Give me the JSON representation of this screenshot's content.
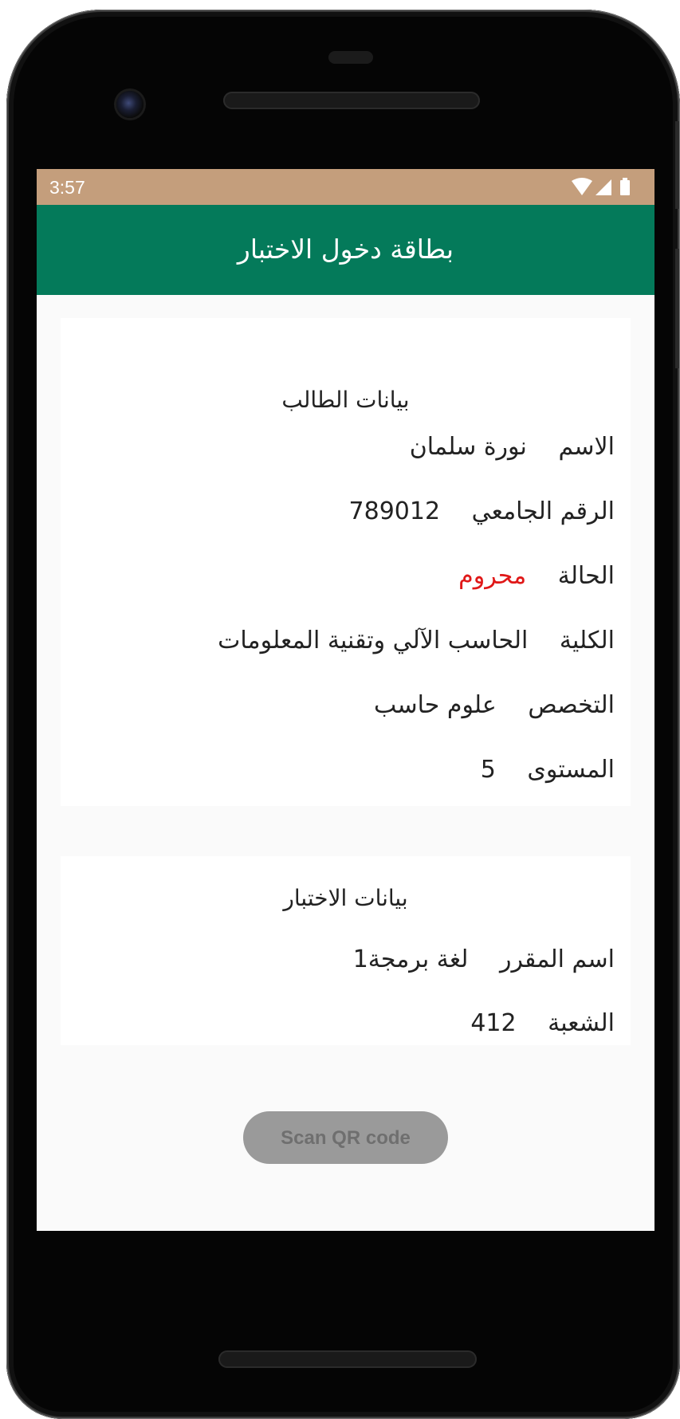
{
  "status_bar": {
    "time": "3:57",
    "icons": [
      "wifi-icon",
      "cellular-signal-icon",
      "battery-icon"
    ]
  },
  "app_bar": {
    "title": "بطاقة دخول الاختبار"
  },
  "student_card": {
    "heading": "بيانات الطالب",
    "rows": [
      {
        "label": "الاسم",
        "value": "نورة سلمان"
      },
      {
        "label": "الرقم الجامعي",
        "value": "789012"
      },
      {
        "label": "الحالة",
        "value": "محروم"
      },
      {
        "label": "الكلية",
        "value": "الحاسب الآلي وتقنية المعلومات"
      },
      {
        "label": "التخصص",
        "value": "علوم حاسب"
      },
      {
        "label": "المستوى",
        "value": "5"
      }
    ]
  },
  "exam_card": {
    "heading": "بيانات الاختبار",
    "rows": [
      {
        "label": "اسم المقرر",
        "value": "لغة برمجة1"
      },
      {
        "label": "الشعبة",
        "value": "412"
      }
    ]
  },
  "scan_button": {
    "label": "Scan QR code"
  },
  "colors": {
    "status_bar": "#c49e7c",
    "app_bar": "#047a5a",
    "danger": "#e01818",
    "button_disabled": "#9a9a9a"
  }
}
